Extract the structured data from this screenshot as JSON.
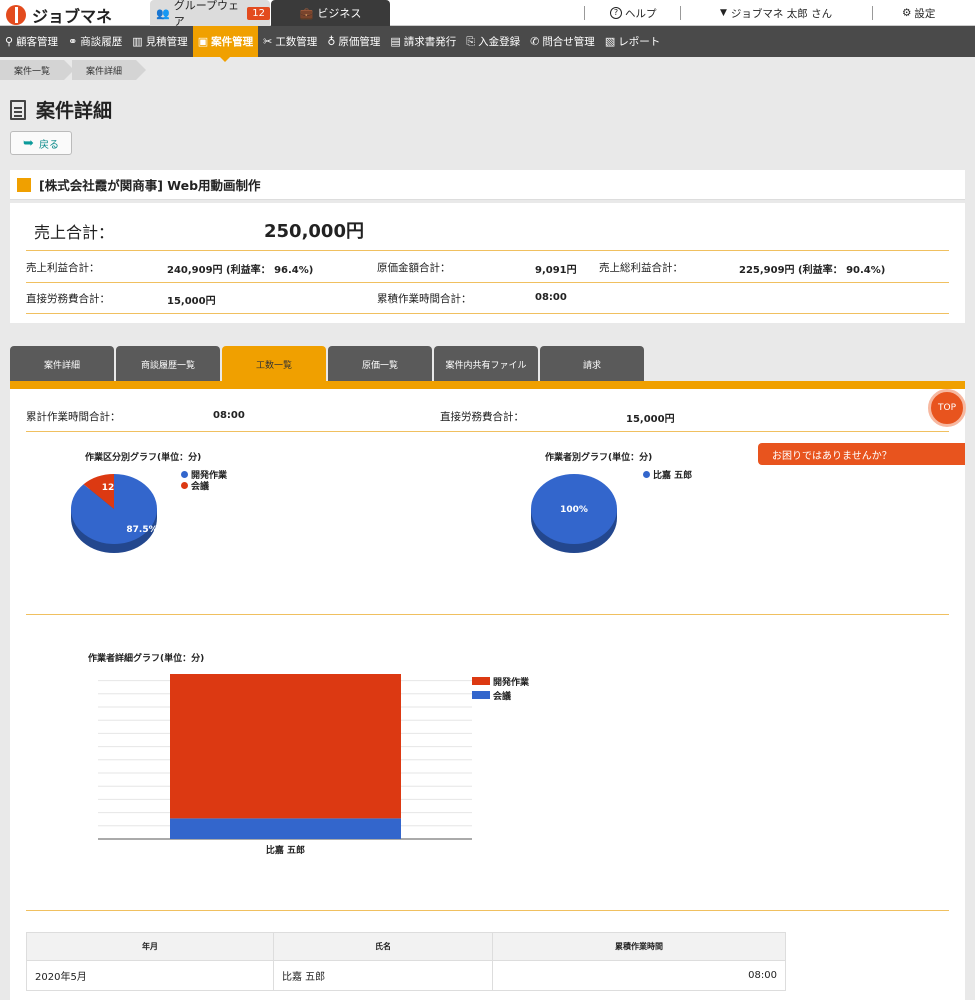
{
  "topbar": {
    "logo": "ジョブマネ",
    "groupware_label": "グループウェア",
    "groupware_badge": "12",
    "business_label": "ビジネス",
    "help_label": "ヘルプ",
    "user_label": "ジョブマネ 太郎 さん",
    "settings_label": "設定"
  },
  "nav": [
    {
      "label": "顧客管理"
    },
    {
      "label": "商談履歴"
    },
    {
      "label": "見積管理"
    },
    {
      "label": "案件管理"
    },
    {
      "label": "工数管理"
    },
    {
      "label": "原価管理"
    },
    {
      "label": "請求書発行"
    },
    {
      "label": "入金登録"
    },
    {
      "label": "問合せ管理"
    },
    {
      "label": "レポート"
    }
  ],
  "breadcrumb": [
    "案件一覧",
    "案件詳細"
  ],
  "page": {
    "title": "案件詳細",
    "back_label": "戻る",
    "project_title": "[株式会社霞が関商事] Web用動画制作"
  },
  "summary": {
    "sales_total_label": "売上合計：",
    "sales_total_value": "250,000円",
    "profit_label": "売上利益合計：",
    "profit_value": "240,909円 (利益率： 96.4%)",
    "cost_label": "原価金額合計：",
    "cost_value": "9,091円",
    "gross_label": "売上総利益合計：",
    "gross_value": "225,909円 (利益率： 90.4%)",
    "labor_label": "直接労務費合計：",
    "labor_value": "15,000円",
    "hours_label": "累積作業時間合計：",
    "hours_value": "08:00"
  },
  "tabs": [
    "案件詳細",
    "商談履歴一覧",
    "工数一覧",
    "原価一覧",
    "案件内共有ファイル",
    "請求"
  ],
  "panel": {
    "hours_label": "累計作業時間合計：",
    "hours_value": "08:00",
    "labor_label": "直接労務費合計：",
    "labor_value": "15,000円",
    "help_label": "お困りではありませんか？",
    "top_label": "TOP"
  },
  "colors": {
    "accent": "#f0a000",
    "dev": "#dc3912",
    "meeting": "#3366cc"
  },
  "chart_data": [
    {
      "type": "pie",
      "title": "作業区分別グラフ(単位：分)",
      "labels": [
        "開発作業",
        "会議"
      ],
      "values": [
        420,
        60
      ],
      "slice_labels": [
        "87.5%",
        "12"
      ]
    },
    {
      "type": "pie",
      "title": "作業者別グラフ(単位：分)",
      "labels": [
        "比嘉 五郎"
      ],
      "values": [
        480
      ],
      "slice_labels": [
        "100%"
      ]
    },
    {
      "type": "bar",
      "title": "作業者詳細グラフ(単位：分)",
      "categories": [
        "比嘉 五郎"
      ],
      "stacked": true,
      "series": [
        {
          "name": "開発作業",
          "values": [
            420
          ]
        },
        {
          "name": "会議",
          "values": [
            60
          ]
        }
      ]
    }
  ],
  "table": {
    "headers": [
      "年月",
      "氏名",
      "累積作業時間"
    ],
    "rows": [
      [
        "2020年5月",
        "比嘉 五郎",
        "08:00"
      ]
    ]
  }
}
